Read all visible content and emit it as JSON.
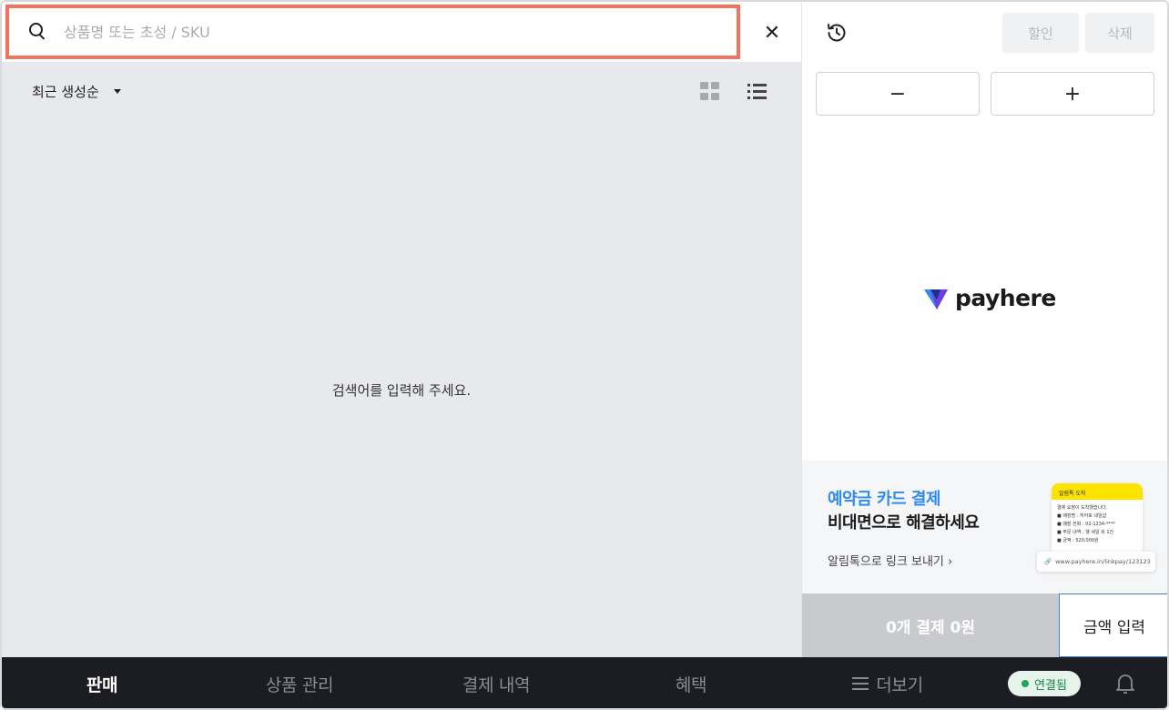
{
  "search": {
    "placeholder": "상품명 또는 초성 / SKU",
    "value": ""
  },
  "sort": {
    "selected": "최근 생성순"
  },
  "empty_message": "검색어를 입력해 주세요.",
  "cart": {
    "discount_label": "할인",
    "delete_label": "삭제",
    "minus_label": "−",
    "plus_label": "+"
  },
  "brand": {
    "logo_text": "payhere",
    "colors": {
      "blue": "#2f8bf0",
      "purple": "#6b3fe0"
    }
  },
  "banner": {
    "title": "예약금 카드 결제",
    "subtitle": "비대면으로 해결하세요",
    "link": "알림톡으로 링크 보내기 ›",
    "card_header": "알림톡 도착",
    "card_lines": [
      "결제 요청이 도착했습니다.",
      "■ 매장명 : 허어로 네임샵",
      "■ 매장 전화 : 02-1234-****",
      "■ 주문 내역 : 웰 세일 외 1건",
      "■ 금액 : 520,000원"
    ],
    "link_url": "www.payhere.in/linkpay/123123"
  },
  "checkout": {
    "summary": "0개 결제  0원",
    "amount_input_label": "금액 입력"
  },
  "nav": {
    "items": [
      {
        "label": "판매",
        "active": true
      },
      {
        "label": "상품 관리",
        "active": false
      },
      {
        "label": "결제 내역",
        "active": false
      },
      {
        "label": "혜택",
        "active": false
      },
      {
        "label": "더보기",
        "active": false
      }
    ],
    "status": "연결됨"
  },
  "colors": {
    "accent_highlight": "#f2735f",
    "status_green": "#1fa85a"
  }
}
